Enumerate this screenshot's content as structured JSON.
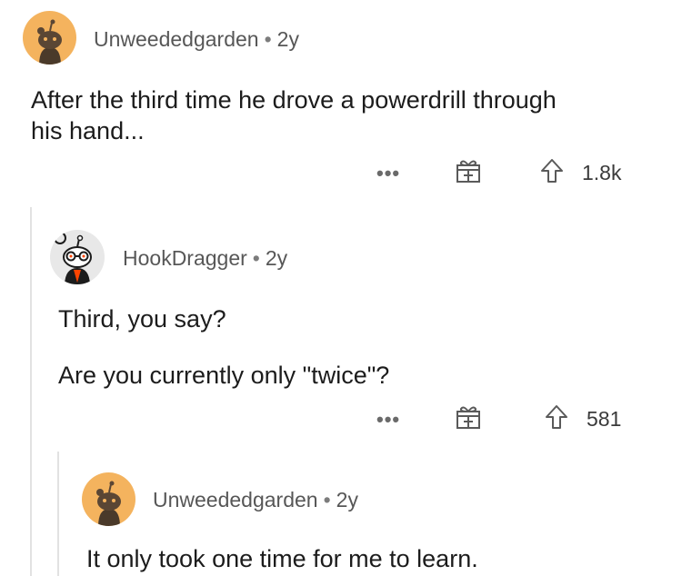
{
  "comments": [
    {
      "user": "Unweededgarden",
      "age": "2y",
      "body": [
        "After the third time he drove a powerdrill through",
        "his hand..."
      ],
      "votes": "1.8k"
    },
    {
      "user": "HookDragger",
      "age": "2y",
      "body": [
        "Third, you say?",
        "Are you currently only \"twice\"?"
      ],
      "votes": "581"
    },
    {
      "user": "Unweededgarden",
      "age": "2y",
      "body": [
        "It only took one time for me to learn."
      ]
    }
  ],
  "ui": {
    "more_label": "•••",
    "separator": "•"
  },
  "icons": {
    "avatar": "snoo-avatar-icon",
    "award": "gift-award-icon",
    "upvote": "upvote-arrow-icon"
  },
  "colors": {
    "avatar_bg_orange": "#f4b35e",
    "avatar_bg_gray": "#e8e8e8",
    "thread_line": "#e2e2e2",
    "accent_orange": "#ff4500"
  }
}
